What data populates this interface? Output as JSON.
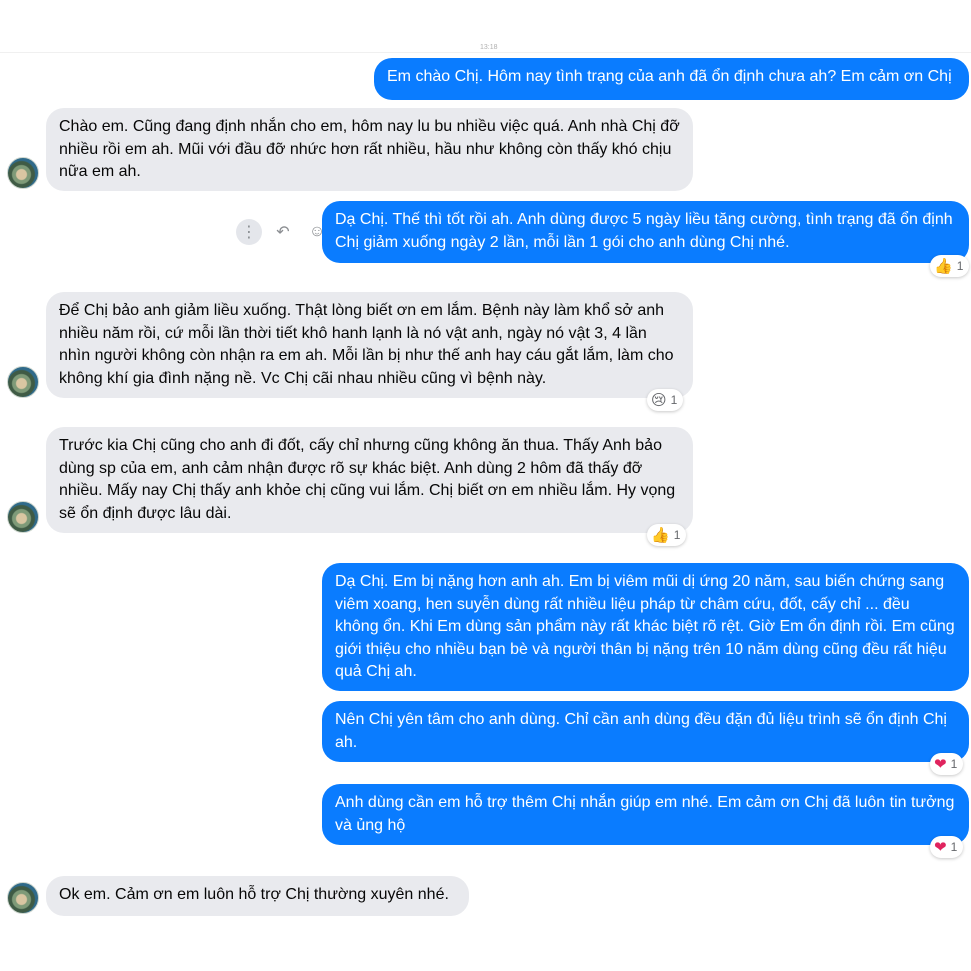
{
  "header": {
    "timestamp": "13:18"
  },
  "messages": [
    {
      "id": "m1",
      "text": "Em chào Chị. Hôm nay tình trạng của anh đã ổn định chưa ah? Em cảm ơn Chị"
    },
    {
      "id": "m2",
      "text": "Chào em. Cũng đang định nhắn cho em, hôm nay lu bu nhiều việc quá. Anh nhà Chị đỡ nhiều rồi em ah. Mũi với đầu đỡ nhức hơn rất nhiều, hầu như không còn thấy khó chịu nữa em ah."
    },
    {
      "id": "m3",
      "text": "Dạ Chị. Thế thì tốt rồi ah. Anh dùng được 5 ngày liều tăng cường, tình trạng đã ổn định Chị giảm xuống ngày 2 lần, mỗi lần 1 gói cho anh dùng Chị nhé.",
      "reaction": {
        "emoji": "👍",
        "count": "1"
      }
    },
    {
      "id": "m4",
      "text": "Để Chị bảo anh giảm liều xuống. Thật lòng biết ơn em lắm. Bệnh này làm khổ sở anh nhiều năm rồi, cứ mỗi lần thời tiết khô hanh lạnh là nó vật anh, ngày nó vật 3, 4 lần nhìn người không còn nhận ra em ah. Mỗi lần bị như thế anh hay cáu gắt lắm, làm cho không khí gia đình nặng nề. Vc Chị cãi nhau nhiều cũng vì bệnh này.",
      "reaction": {
        "emoji": "😢",
        "count": "1"
      }
    },
    {
      "id": "m5",
      "text": "Trước kia Chị cũng cho anh đi đốt, cấy chỉ nhưng cũng không ăn thua. Thấy Anh bảo dùng sp của em, anh cảm nhận được rõ sự khác biệt. Anh dùng 2 hôm đã thấy đỡ nhiều. Mấy nay Chị thấy anh khỏe chị cũng vui lắm. Chị biết ơn em nhiều lắm. Hy vọng sẽ ổn định được lâu dài.",
      "reaction": {
        "emoji": "👍",
        "count": "1"
      }
    },
    {
      "id": "m6",
      "text": "Dạ Chị. Em bị nặng hơn anh ah. Em bị viêm mũi dị ứng 20 năm, sau biến chứng sang viêm xoang, hen suyễn dùng rất nhiều liệu pháp từ châm cứu, đốt, cấy chỉ ... đều không ổn. Khi Em dùng sản phẩm này rất khác biệt rõ rệt. Giờ Em ổn định rồi. Em cũng giới thiệu cho nhiều bạn bè và người thân bị nặng trên 10 năm dùng cũng đều rất hiệu quả Chị ah."
    },
    {
      "id": "m7",
      "text": "Nên Chị yên tâm cho anh dùng. Chỉ cần anh dùng đều đặn đủ liệu trình sẽ ổn định Chị ah.",
      "reaction": {
        "emoji": "❤",
        "count": "1"
      }
    },
    {
      "id": "m8",
      "text": "Anh dùng cần em hỗ trợ thêm Chị nhắn giúp em nhé. Em cảm ơn Chị đã luôn tin tưởng và ủng hộ",
      "reaction": {
        "emoji": "❤",
        "count": "1"
      }
    },
    {
      "id": "m9",
      "text": "Ok em. Cảm ơn em luôn hỗ trợ Chị thường xuyên nhé."
    }
  ],
  "hover_tools": {
    "more": "⋮",
    "reply": "↶",
    "emoji": "☺"
  },
  "colors": {
    "outgoing": "#0a7cff",
    "incoming": "#e9eaee",
    "text_dark": "#070707"
  }
}
